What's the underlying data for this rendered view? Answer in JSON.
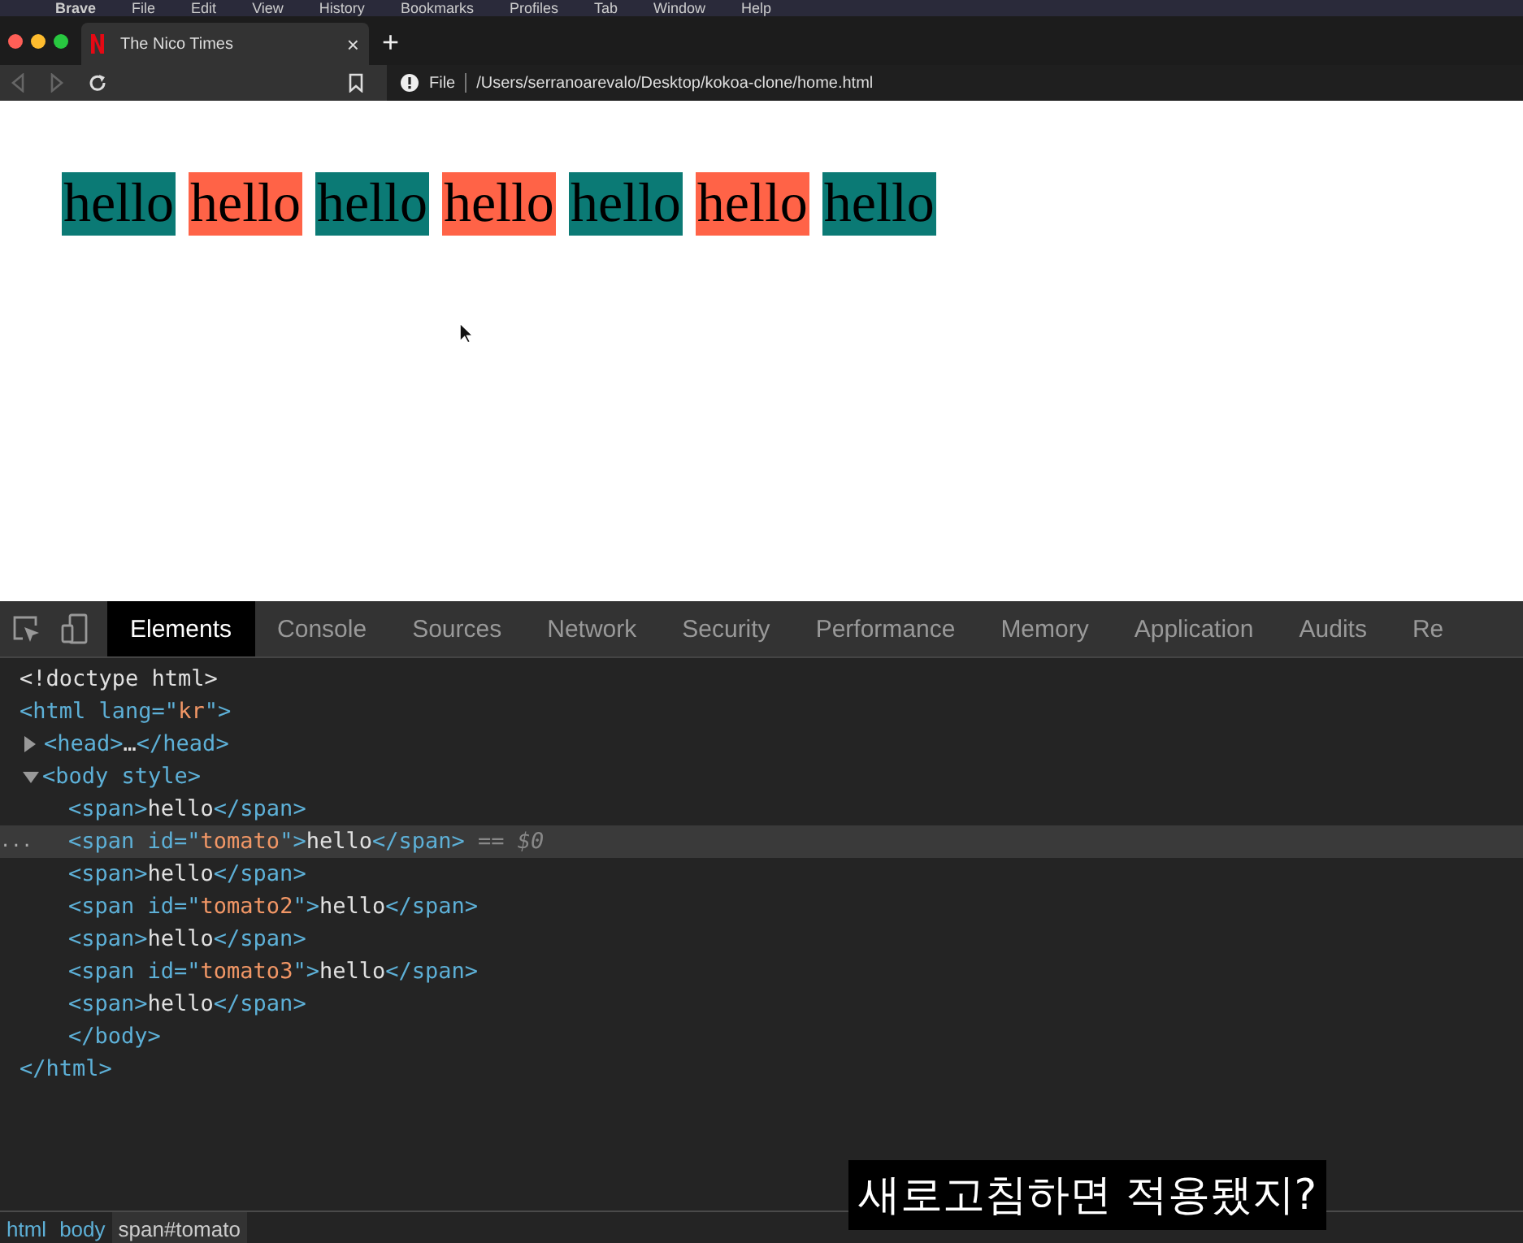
{
  "menu_bar": [
    {
      "label": "Brave",
      "kind": "app"
    },
    {
      "label": "File",
      "kind": "menu"
    },
    {
      "label": "Edit",
      "kind": "menu"
    },
    {
      "label": "View",
      "kind": "menu"
    },
    {
      "label": "History",
      "kind": "menu"
    },
    {
      "label": "Bookmarks",
      "kind": "menu"
    },
    {
      "label": "Profiles",
      "kind": "menu"
    },
    {
      "label": "Tab",
      "kind": "menu"
    },
    {
      "label": "Window",
      "kind": "menu"
    },
    {
      "label": "Help",
      "kind": "menu"
    }
  ],
  "browser_tabs": [
    {
      "title": "The Nico Times",
      "selected": true,
      "close": "×"
    }
  ],
  "new_tab": "+",
  "address_bar": {
    "scheme": "File",
    "url": "/Users/serranoarevalo/Desktop/kokoa-clone/home.html"
  },
  "page": {
    "spans": [
      {
        "text": "hello",
        "color": "#0b7a75"
      },
      {
        "text": "hello",
        "color": "#ff6347"
      },
      {
        "text": "hello",
        "color": "#0b7a75"
      },
      {
        "text": "hello",
        "color": "#ff6347"
      },
      {
        "text": "hello",
        "color": "#0b7a75"
      },
      {
        "text": "hello",
        "color": "#ff6347"
      },
      {
        "text": "hello",
        "color": "#0b7a75"
      }
    ]
  },
  "devtools": {
    "tabs": [
      {
        "label": "Elements",
        "selected": true
      },
      {
        "label": "Console",
        "selected": false
      },
      {
        "label": "Sources",
        "selected": false
      },
      {
        "label": "Network",
        "selected": false
      },
      {
        "label": "Security",
        "selected": false
      },
      {
        "label": "Performance",
        "selected": false
      },
      {
        "label": "Memory",
        "selected": false
      },
      {
        "label": "Application",
        "selected": false
      },
      {
        "label": "Audits",
        "selected": false
      },
      {
        "label": "Re",
        "selected": false
      }
    ],
    "dom_tree": [
      {
        "selected": false,
        "open": [
          {
            "kind": "plain",
            "text": "<!doctype html>"
          }
        ]
      },
      {
        "selected": false,
        "open": [
          {
            "kind": "tag",
            "text": "<html "
          },
          {
            "kind": "attr",
            "text": "lang=\""
          },
          {
            "kind": "value",
            "text": "kr"
          },
          {
            "kind": "attr",
            "text": "\""
          },
          {
            "kind": "tag",
            "text": ">"
          }
        ],
        "close": [
          {
            "kind": "tag",
            "text": "</html>"
          }
        ],
        "children": [
          {
            "selected": false,
            "expanded": false,
            "open": [
              {
                "kind": "tag",
                "text": "<head>"
              },
              {
                "kind": "plain",
                "text": "…"
              },
              {
                "kind": "tag",
                "text": "</head>"
              }
            ]
          },
          {
            "selected": false,
            "expanded": true,
            "open": [
              {
                "kind": "tag",
                "text": "<body "
              },
              {
                "kind": "attr",
                "text": "style"
              },
              {
                "kind": "tag",
                "text": ">"
              }
            ],
            "close": [
              {
                "kind": "tag",
                "text": "</body>"
              }
            ],
            "children": [
              {
                "selected": false,
                "open": [
                  {
                    "kind": "tag",
                    "text": "<span>"
                  },
                  {
                    "kind": "plain",
                    "text": "hello"
                  },
                  {
                    "kind": "tag",
                    "text": "</span>"
                  }
                ]
              },
              {
                "selected": true,
                "marker": "...",
                "open": [
                  {
                    "kind": "tag",
                    "text": "<span "
                  },
                  {
                    "kind": "attr",
                    "text": "id=\""
                  },
                  {
                    "kind": "value",
                    "text": "tomato"
                  },
                  {
                    "kind": "attr",
                    "text": "\""
                  },
                  {
                    "kind": "tag",
                    "text": ">"
                  },
                  {
                    "kind": "plain",
                    "text": "hello"
                  },
                  {
                    "kind": "tag",
                    "text": "</span>"
                  },
                  {
                    "kind": "hint",
                    "text": " == $0"
                  }
                ]
              },
              {
                "selected": false,
                "open": [
                  {
                    "kind": "tag",
                    "text": "<span>"
                  },
                  {
                    "kind": "plain",
                    "text": "hello"
                  },
                  {
                    "kind": "tag",
                    "text": "</span>"
                  }
                ]
              },
              {
                "selected": false,
                "open": [
                  {
                    "kind": "tag",
                    "text": "<span "
                  },
                  {
                    "kind": "attr",
                    "text": "id=\""
                  },
                  {
                    "kind": "value",
                    "text": "tomato2"
                  },
                  {
                    "kind": "attr",
                    "text": "\""
                  },
                  {
                    "kind": "tag",
                    "text": ">"
                  },
                  {
                    "kind": "plain",
                    "text": "hello"
                  },
                  {
                    "kind": "tag",
                    "text": "</span>"
                  }
                ]
              },
              {
                "selected": false,
                "open": [
                  {
                    "kind": "tag",
                    "text": "<span>"
                  },
                  {
                    "kind": "plain",
                    "text": "hello"
                  },
                  {
                    "kind": "tag",
                    "text": "</span>"
                  }
                ]
              },
              {
                "selected": false,
                "open": [
                  {
                    "kind": "tag",
                    "text": "<span "
                  },
                  {
                    "kind": "attr",
                    "text": "id=\""
                  },
                  {
                    "kind": "value",
                    "text": "tomato3"
                  },
                  {
                    "kind": "attr",
                    "text": "\""
                  },
                  {
                    "kind": "tag",
                    "text": ">"
                  },
                  {
                    "kind": "plain",
                    "text": "hello"
                  },
                  {
                    "kind": "tag",
                    "text": "</span>"
                  }
                ]
              },
              {
                "selected": false,
                "open": [
                  {
                    "kind": "tag",
                    "text": "<span>"
                  },
                  {
                    "kind": "plain",
                    "text": "hello"
                  },
                  {
                    "kind": "tag",
                    "text": "</span>"
                  }
                ]
              }
            ]
          }
        ]
      }
    ],
    "breadcrumbs": [
      {
        "label": "html",
        "selected": false
      },
      {
        "label": "body",
        "selected": false
      },
      {
        "label": "span#tomato",
        "selected": true
      }
    ]
  },
  "caption": "새로고침하면 적용됐지?"
}
